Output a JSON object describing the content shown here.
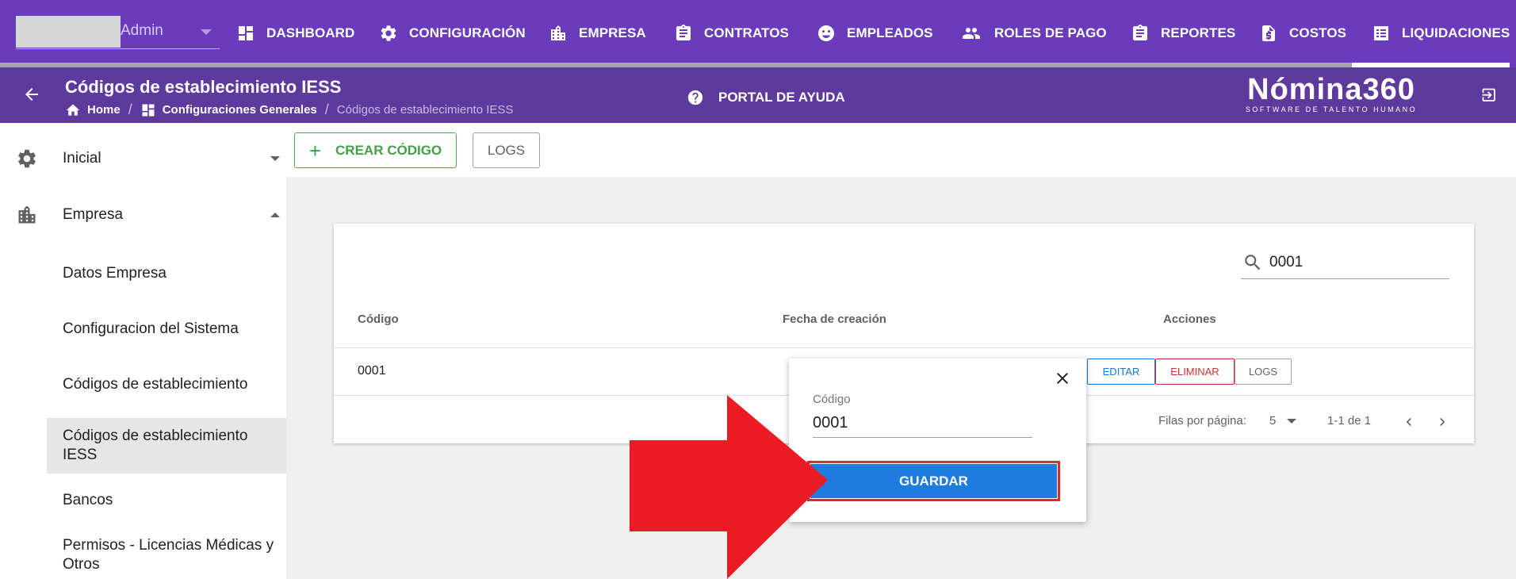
{
  "user": {
    "name": "Admin"
  },
  "nav": {
    "items": [
      {
        "label": "DASHBOARD",
        "icon": "dashboard-icon"
      },
      {
        "label": "CONFIGURACIÓN",
        "icon": "gear-icon"
      },
      {
        "label": "EMPRESA",
        "icon": "building-icon"
      },
      {
        "label": "CONTRATOS",
        "icon": "clipboard-icon"
      },
      {
        "label": "EMPLEADOS",
        "icon": "face-icon"
      },
      {
        "label": "ROLES DE PAGO",
        "icon": "people-icon"
      },
      {
        "label": "REPORTES",
        "icon": "clipboard-icon"
      },
      {
        "label": "COSTOS",
        "icon": "invoice-icon"
      },
      {
        "label": "LIQUIDACIONES",
        "icon": "list-icon"
      }
    ]
  },
  "header": {
    "title": "Códigos de establecimiento IESS",
    "breadcrumb": {
      "home": "Home",
      "parent": "Configuraciones Generales",
      "current": "Códigos de establecimiento IESS"
    },
    "help": "PORTAL DE AYUDA",
    "logo": {
      "main": "Nómina360",
      "sub": "SOFTWARE DE TALENTO HUMANO"
    }
  },
  "sidebar": {
    "groups": [
      {
        "label": "Inicial",
        "icon": "gear-icon",
        "expanded": false
      },
      {
        "label": "Empresa",
        "icon": "building-icon",
        "expanded": true
      }
    ],
    "items": [
      {
        "label": "Datos Empresa"
      },
      {
        "label": "Configuracion del Sistema"
      },
      {
        "label": "Códigos de establecimiento"
      },
      {
        "label": "Códigos de establecimiento IESS",
        "active": true
      },
      {
        "label": "Bancos"
      },
      {
        "label": "Permisos - Licencias Médicas y Otros"
      }
    ]
  },
  "toolbar": {
    "create_label": "CREAR CÓDIGO",
    "logs_label": "LOGS"
  },
  "table": {
    "search_value": "0001",
    "headers": {
      "code": "Código",
      "created": "Fecha de creación",
      "actions": "Acciones"
    },
    "rows": [
      {
        "code": "0001",
        "created": ""
      }
    ],
    "actions": {
      "edit": "EDITAR",
      "delete": "ELIMINAR",
      "logs": "LOGS"
    },
    "footer": {
      "rows_per_page_label": "Filas por página:",
      "rows_per_page": "5",
      "range": "1-1 de 1"
    }
  },
  "popover": {
    "label": "Código",
    "value": "0001",
    "save_label": "GUARDAR"
  },
  "colors": {
    "nav_bg": "#6a3bbd",
    "subheader_bg": "#5f3a9e",
    "create_green": "#43a047",
    "save_blue": "#1e7be0",
    "highlight_red": "#e02a2a",
    "delete_red": "#d32f2f",
    "edit_blue": "#1976d2"
  }
}
